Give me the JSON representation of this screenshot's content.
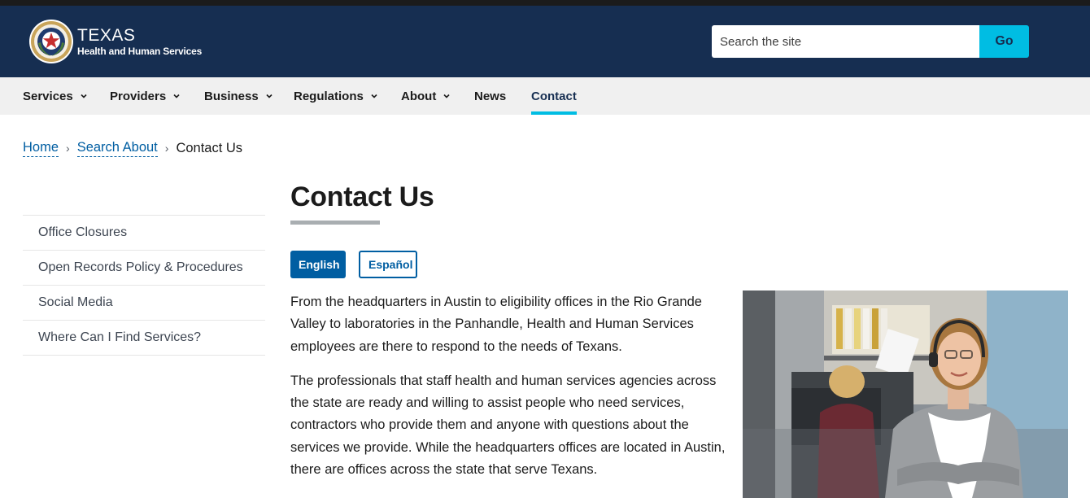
{
  "header": {
    "logo_main": "TEXAS",
    "logo_sub": "Health and Human Services",
    "search_placeholder": "Search the site",
    "search_button": "Go"
  },
  "nav": {
    "items": [
      {
        "label": "Services",
        "dropdown": true
      },
      {
        "label": "Providers",
        "dropdown": true
      },
      {
        "label": "Business",
        "dropdown": true
      },
      {
        "label": "Regulations",
        "dropdown": true
      },
      {
        "label": "About",
        "dropdown": true
      },
      {
        "label": "News",
        "dropdown": false
      },
      {
        "label": "Contact",
        "dropdown": false,
        "active": true
      }
    ]
  },
  "breadcrumb": {
    "items": [
      "Home",
      "Search About"
    ],
    "current": "Contact Us"
  },
  "sidenav": {
    "items": [
      "Office Closures",
      "Open Records Policy & Procedures",
      "Social Media",
      "Where Can I Find Services?"
    ]
  },
  "main": {
    "title": "Contact Us",
    "lang_buttons": [
      "English",
      "Español"
    ],
    "paragraphs": [
      "From the headquarters in Austin to eligibility offices in the Rio Grande Valley to laboratories in the Panhandle, Health and Human Services employees are there to respond to the needs of Texans.",
      "The professionals that staff health and human services agencies across the state are ready and willing to assist people who need services, contractors who provide them and anyone with questions about the services we provide. While the headquarters offices are located in Austin, there are offices across the state that serve Texans."
    ]
  },
  "colors": {
    "header_bg": "#162e51",
    "accent_cyan": "#00bde3",
    "link_blue": "#005ea2",
    "nav_bg": "#f0f0f0"
  }
}
